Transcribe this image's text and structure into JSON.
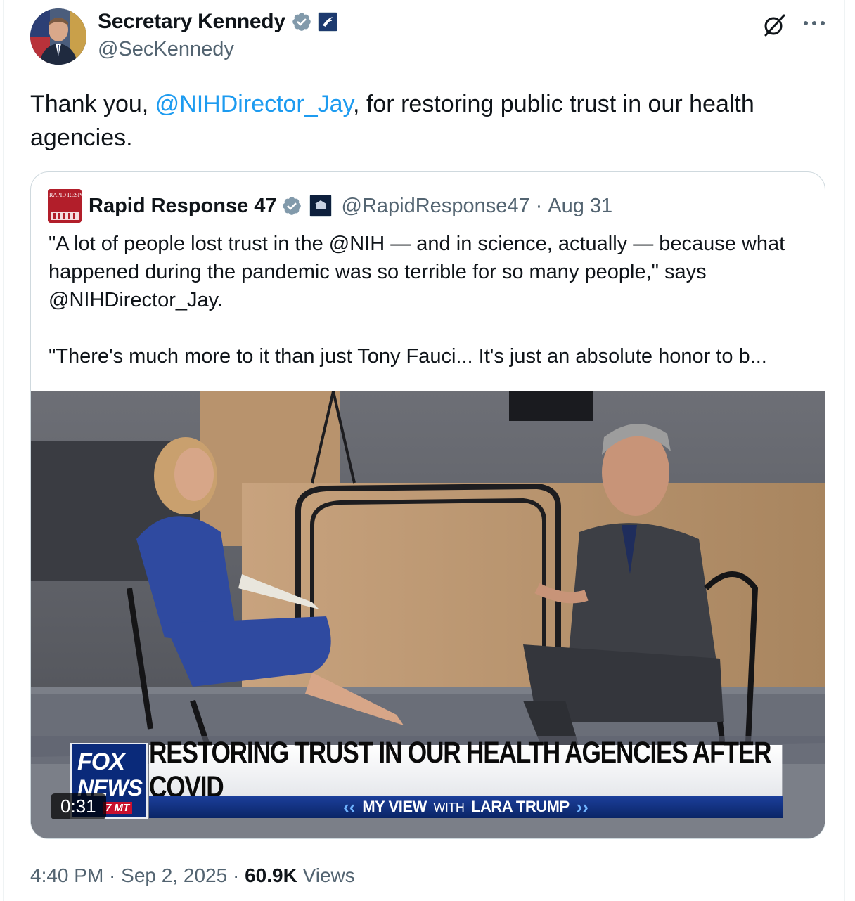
{
  "tweet": {
    "author": {
      "name": "Secretary Kennedy",
      "handle": "@SecKennedy"
    },
    "text_before": "Thank you, ",
    "mention": "@NIHDirector_Jay",
    "text_after": ", for restoring public trust in our health agencies.",
    "timestamp": "4:40 PM · Sep 2, 2025",
    "separator": " · ",
    "views_count": "60.9K",
    "views_label": " Views"
  },
  "quoted": {
    "author": {
      "name": "Rapid Response 47",
      "handle": "@RapidResponse47"
    },
    "dot": "·",
    "date": "Aug 31",
    "text": "\"A lot of people lost trust in the @NIH — and in science, actually — because what happened during the pandemic was so terrible for so many people,\" says @NIHDirector_Jay.\n\n\"There's much more to it than just Tony Fauci... It's just an absolute honor to b...",
    "avatar_text": "RAPID RESPONSE",
    "video": {
      "duration": "0:31",
      "headline": "RESTORING TRUST IN OUR HEALTH AGENCIES AFTER COVID",
      "subtitle_main": "MY VIEW",
      "subtitle_with": "WITH",
      "subtitle_host": "LARA TRUMP",
      "network_word1": "FOX",
      "network_word2": "NEWS",
      "timezone": "7 MT"
    }
  },
  "icons": {
    "verified": "verified-badge-icon",
    "affiliation": "hhs-affiliation-icon",
    "grok": "grok-icon",
    "more": "more-icon",
    "white_house": "white-house-affiliation-icon"
  },
  "colors": {
    "link": "#1d9bf0",
    "verified": "#829aab",
    "secondary": "#536471"
  }
}
